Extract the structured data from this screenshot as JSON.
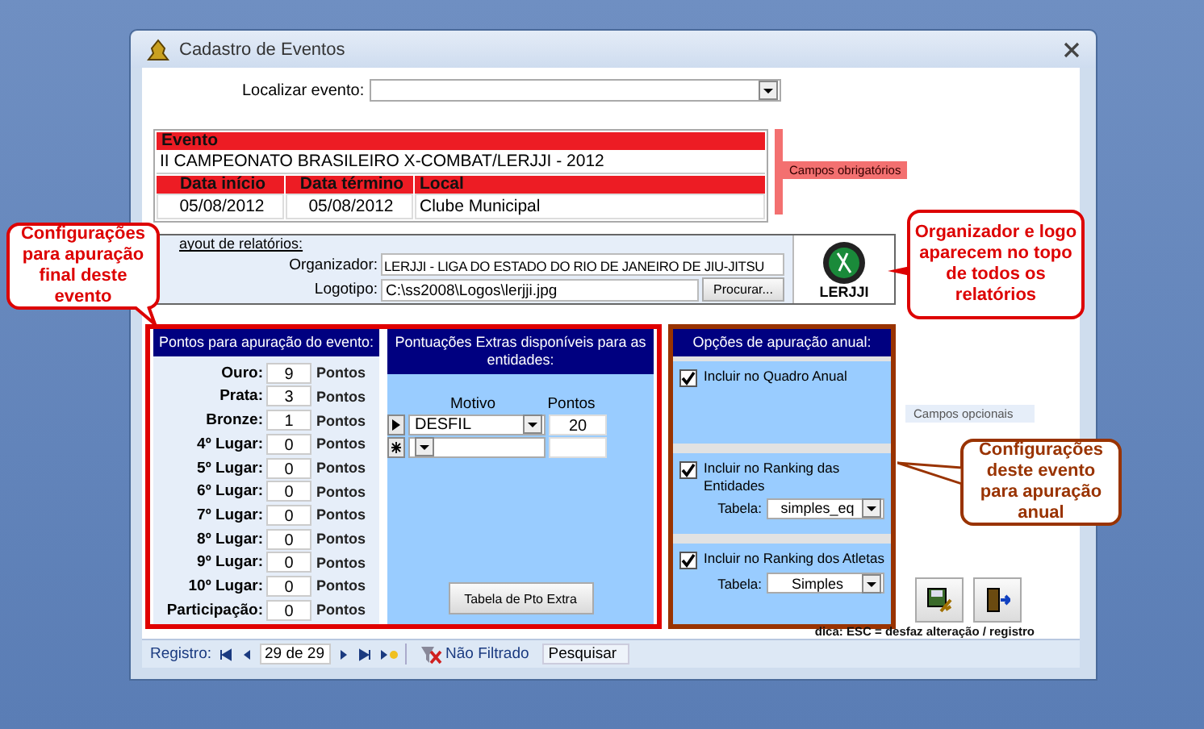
{
  "window": {
    "title": "Cadastro de Eventos"
  },
  "search": {
    "label": "Localizar evento:"
  },
  "event": {
    "header": "Evento",
    "name": "II CAMPEONATO BRASILEIRO X-COMBAT/LERJJI - 2012",
    "columns": [
      {
        "header": "Data início",
        "value": "05/08/2012"
      },
      {
        "header": "Data término",
        "value": "05/08/2012"
      },
      {
        "header": "Local",
        "value": "Clube Municipal"
      }
    ]
  },
  "required_note": "Campos obrigatórios",
  "report_layout": {
    "title": "ayout de relatórios:",
    "organizer_label": "Organizador:",
    "organizer": "LERJJI - LIGA DO ESTADO DO RIO DE JANEIRO DE JIU-JITSU",
    "logo_label": "Logotipo:",
    "logo_path": "C:\\ss2008\\Logos\\lerjji.jpg",
    "browse": "Procurar...",
    "logo_text": "LERJJI"
  },
  "points": {
    "title": "Pontos para apuração do evento:",
    "rows": [
      {
        "label": "Ouro:",
        "value": "9",
        "unit": "Pontos"
      },
      {
        "label": "Prata:",
        "value": "3",
        "unit": "Pontos"
      },
      {
        "label": "Bronze:",
        "value": "1",
        "unit": "Pontos"
      },
      {
        "label": "4º Lugar:",
        "value": "0",
        "unit": "Pontos"
      },
      {
        "label": "5º Lugar:",
        "value": "0",
        "unit": "Pontos"
      },
      {
        "label": "6º Lugar:",
        "value": "0",
        "unit": "Pontos"
      },
      {
        "label": "7º Lugar:",
        "value": "0",
        "unit": "Pontos"
      },
      {
        "label": "8º Lugar:",
        "value": "0",
        "unit": "Pontos"
      },
      {
        "label": "9º Lugar:",
        "value": "0",
        "unit": "Pontos"
      },
      {
        "label": "10º Lugar:",
        "value": "0",
        "unit": "Pontos"
      },
      {
        "label": "Participação:",
        "value": "0",
        "unit": "Pontos"
      }
    ]
  },
  "extras": {
    "title": "Pontuações Extras disponíveis para as entidades:",
    "columns": [
      "Motivo",
      "Pontos"
    ],
    "rows": [
      {
        "kind": "current",
        "motivo": "DESFIL",
        "pontos": "20"
      },
      {
        "kind": "new"
      }
    ],
    "button": "Tabela de Pto Extra"
  },
  "annual": {
    "title": "Opções de apuração anual:",
    "options": [
      {
        "label": "Incluir no Quadro Anual",
        "checked": true
      },
      {
        "label": "Incluir no Ranking das Entidades",
        "checked": true,
        "table_label": "Tabela:",
        "table_value": "simples_eq"
      },
      {
        "label": "Incluir no Ranking dos Atletas",
        "checked": true,
        "table_label": "Tabela:",
        "table_value": "Simples"
      }
    ]
  },
  "optional_note": "Campos opcionais",
  "hint": "dica: ESC = desfaz alteração / registro",
  "status_bar": {
    "label": "Registro:",
    "position": "29 de 29",
    "filter": "Não Filtrado",
    "search": "Pesquisar"
  },
  "callouts": [
    {
      "text": "Configurações para apuração final deste evento",
      "color": "#dd0000"
    },
    {
      "text": "Organizador e logo aparecem no topo de todos os relatórios",
      "color": "#dd0000"
    },
    {
      "text": "Configurações deste evento para apuração anual",
      "color": "#993300"
    }
  ]
}
